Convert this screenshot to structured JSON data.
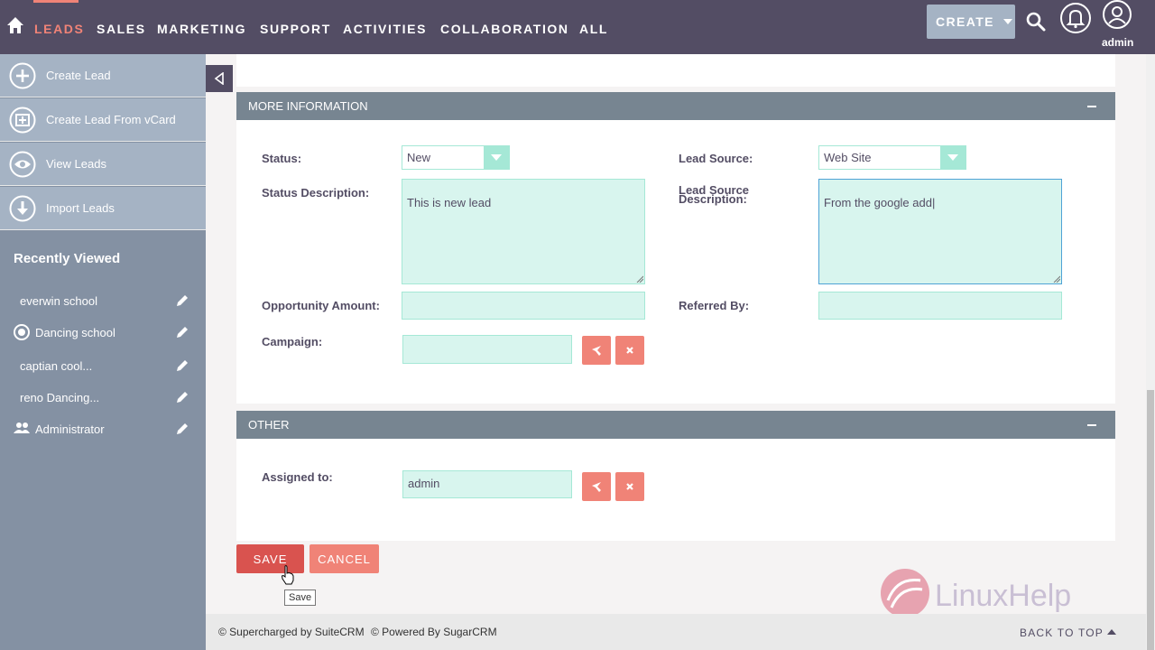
{
  "nav": {
    "items": [
      "LEADS",
      "SALES",
      "MARKETING",
      "SUPPORT",
      "ACTIVITIES",
      "COLLABORATION",
      "ALL"
    ],
    "active": "LEADS",
    "create_label": "CREATE",
    "user_label": "admin"
  },
  "sidebar": {
    "actions": [
      {
        "label": "Create Lead",
        "icon": "plus-circle-icon"
      },
      {
        "label": "Create Lead From vCard",
        "icon": "vcard-icon"
      },
      {
        "label": "View Leads",
        "icon": "eye-icon"
      },
      {
        "label": "Import Leads",
        "icon": "download-icon"
      }
    ],
    "recent_title": "Recently Viewed",
    "recent": [
      {
        "label": "everwin school",
        "icon": ""
      },
      {
        "label": "Dancing school",
        "icon": "target-icon"
      },
      {
        "label": "captian cool...",
        "icon": ""
      },
      {
        "label": "reno Dancing...",
        "icon": ""
      },
      {
        "label": "Administrator",
        "icon": "users-icon"
      }
    ]
  },
  "more_info": {
    "title": "MORE INFORMATION",
    "status_label": "Status:",
    "status_value": "New",
    "lead_source_label": "Lead Source:",
    "lead_source_value": "Web Site",
    "status_desc_label": "Status Description:",
    "status_desc_value": "This is new lead",
    "lead_source_desc_label_1": "Lead Source",
    "lead_source_desc_label_2": "Description:",
    "lead_source_desc_value": "From the google add|",
    "opp_amount_label": "Opportunity Amount:",
    "opp_amount_value": "",
    "referred_by_label": "Referred By:",
    "referred_by_value": "",
    "campaign_label": "Campaign:",
    "campaign_value": ""
  },
  "other": {
    "title": "OTHER",
    "assigned_label": "Assigned to:",
    "assigned_value": "admin"
  },
  "buttons": {
    "save": "SAVE",
    "cancel": "CANCEL",
    "tooltip": "Save"
  },
  "footer": {
    "supercharged": "© Supercharged by SuiteCRM",
    "powered": "© Powered By SugarCRM",
    "back_to_top": "BACK TO TOP"
  },
  "colors": {
    "nav_bg": "#534d64",
    "accent": "#f08377",
    "sidebar_bg": "#8491a3",
    "panel_header": "#778591",
    "field_bg": "#d8f5ee"
  }
}
